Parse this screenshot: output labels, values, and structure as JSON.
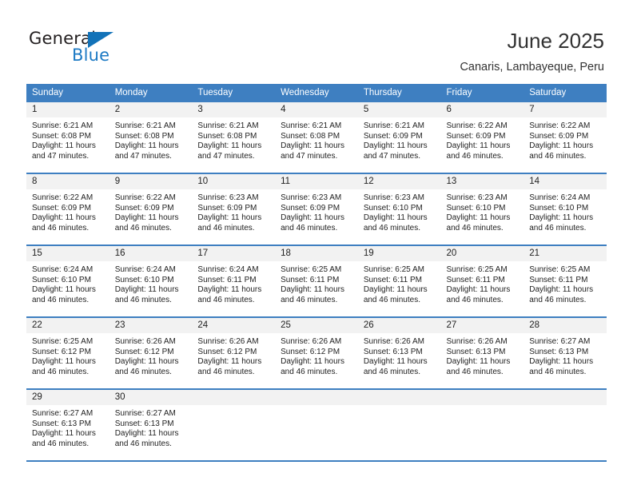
{
  "brand": {
    "name_top": "General",
    "name_bottom": "Blue",
    "accent_color": "#1272b8"
  },
  "header": {
    "title": "June 2025",
    "subtitle": "Canaris, Lambayeque, Peru"
  },
  "calendar": {
    "header_bg": "#3e7fc1",
    "daynum_bg": "#f2f2f2",
    "weekday_headers": [
      "Sunday",
      "Monday",
      "Tuesday",
      "Wednesday",
      "Thursday",
      "Friday",
      "Saturday"
    ],
    "weeks": [
      [
        {
          "day": "1",
          "sunrise": "Sunrise: 6:21 AM",
          "sunset": "Sunset: 6:08 PM",
          "daylight_line1": "Daylight: 11 hours",
          "daylight_line2": "and 47 minutes."
        },
        {
          "day": "2",
          "sunrise": "Sunrise: 6:21 AM",
          "sunset": "Sunset: 6:08 PM",
          "daylight_line1": "Daylight: 11 hours",
          "daylight_line2": "and 47 minutes."
        },
        {
          "day": "3",
          "sunrise": "Sunrise: 6:21 AM",
          "sunset": "Sunset: 6:08 PM",
          "daylight_line1": "Daylight: 11 hours",
          "daylight_line2": "and 47 minutes."
        },
        {
          "day": "4",
          "sunrise": "Sunrise: 6:21 AM",
          "sunset": "Sunset: 6:08 PM",
          "daylight_line1": "Daylight: 11 hours",
          "daylight_line2": "and 47 minutes."
        },
        {
          "day": "5",
          "sunrise": "Sunrise: 6:21 AM",
          "sunset": "Sunset: 6:09 PM",
          "daylight_line1": "Daylight: 11 hours",
          "daylight_line2": "and 47 minutes."
        },
        {
          "day": "6",
          "sunrise": "Sunrise: 6:22 AM",
          "sunset": "Sunset: 6:09 PM",
          "daylight_line1": "Daylight: 11 hours",
          "daylight_line2": "and 46 minutes."
        },
        {
          "day": "7",
          "sunrise": "Sunrise: 6:22 AM",
          "sunset": "Sunset: 6:09 PM",
          "daylight_line1": "Daylight: 11 hours",
          "daylight_line2": "and 46 minutes."
        }
      ],
      [
        {
          "day": "8",
          "sunrise": "Sunrise: 6:22 AM",
          "sunset": "Sunset: 6:09 PM",
          "daylight_line1": "Daylight: 11 hours",
          "daylight_line2": "and 46 minutes."
        },
        {
          "day": "9",
          "sunrise": "Sunrise: 6:22 AM",
          "sunset": "Sunset: 6:09 PM",
          "daylight_line1": "Daylight: 11 hours",
          "daylight_line2": "and 46 minutes."
        },
        {
          "day": "10",
          "sunrise": "Sunrise: 6:23 AM",
          "sunset": "Sunset: 6:09 PM",
          "daylight_line1": "Daylight: 11 hours",
          "daylight_line2": "and 46 minutes."
        },
        {
          "day": "11",
          "sunrise": "Sunrise: 6:23 AM",
          "sunset": "Sunset: 6:09 PM",
          "daylight_line1": "Daylight: 11 hours",
          "daylight_line2": "and 46 minutes."
        },
        {
          "day": "12",
          "sunrise": "Sunrise: 6:23 AM",
          "sunset": "Sunset: 6:10 PM",
          "daylight_line1": "Daylight: 11 hours",
          "daylight_line2": "and 46 minutes."
        },
        {
          "day": "13",
          "sunrise": "Sunrise: 6:23 AM",
          "sunset": "Sunset: 6:10 PM",
          "daylight_line1": "Daylight: 11 hours",
          "daylight_line2": "and 46 minutes."
        },
        {
          "day": "14",
          "sunrise": "Sunrise: 6:24 AM",
          "sunset": "Sunset: 6:10 PM",
          "daylight_line1": "Daylight: 11 hours",
          "daylight_line2": "and 46 minutes."
        }
      ],
      [
        {
          "day": "15",
          "sunrise": "Sunrise: 6:24 AM",
          "sunset": "Sunset: 6:10 PM",
          "daylight_line1": "Daylight: 11 hours",
          "daylight_line2": "and 46 minutes."
        },
        {
          "day": "16",
          "sunrise": "Sunrise: 6:24 AM",
          "sunset": "Sunset: 6:10 PM",
          "daylight_line1": "Daylight: 11 hours",
          "daylight_line2": "and 46 minutes."
        },
        {
          "day": "17",
          "sunrise": "Sunrise: 6:24 AM",
          "sunset": "Sunset: 6:11 PM",
          "daylight_line1": "Daylight: 11 hours",
          "daylight_line2": "and 46 minutes."
        },
        {
          "day": "18",
          "sunrise": "Sunrise: 6:25 AM",
          "sunset": "Sunset: 6:11 PM",
          "daylight_line1": "Daylight: 11 hours",
          "daylight_line2": "and 46 minutes."
        },
        {
          "day": "19",
          "sunrise": "Sunrise: 6:25 AM",
          "sunset": "Sunset: 6:11 PM",
          "daylight_line1": "Daylight: 11 hours",
          "daylight_line2": "and 46 minutes."
        },
        {
          "day": "20",
          "sunrise": "Sunrise: 6:25 AM",
          "sunset": "Sunset: 6:11 PM",
          "daylight_line1": "Daylight: 11 hours",
          "daylight_line2": "and 46 minutes."
        },
        {
          "day": "21",
          "sunrise": "Sunrise: 6:25 AM",
          "sunset": "Sunset: 6:11 PM",
          "daylight_line1": "Daylight: 11 hours",
          "daylight_line2": "and 46 minutes."
        }
      ],
      [
        {
          "day": "22",
          "sunrise": "Sunrise: 6:25 AM",
          "sunset": "Sunset: 6:12 PM",
          "daylight_line1": "Daylight: 11 hours",
          "daylight_line2": "and 46 minutes."
        },
        {
          "day": "23",
          "sunrise": "Sunrise: 6:26 AM",
          "sunset": "Sunset: 6:12 PM",
          "daylight_line1": "Daylight: 11 hours",
          "daylight_line2": "and 46 minutes."
        },
        {
          "day": "24",
          "sunrise": "Sunrise: 6:26 AM",
          "sunset": "Sunset: 6:12 PM",
          "daylight_line1": "Daylight: 11 hours",
          "daylight_line2": "and 46 minutes."
        },
        {
          "day": "25",
          "sunrise": "Sunrise: 6:26 AM",
          "sunset": "Sunset: 6:12 PM",
          "daylight_line1": "Daylight: 11 hours",
          "daylight_line2": "and 46 minutes."
        },
        {
          "day": "26",
          "sunrise": "Sunrise: 6:26 AM",
          "sunset": "Sunset: 6:13 PM",
          "daylight_line1": "Daylight: 11 hours",
          "daylight_line2": "and 46 minutes."
        },
        {
          "day": "27",
          "sunrise": "Sunrise: 6:26 AM",
          "sunset": "Sunset: 6:13 PM",
          "daylight_line1": "Daylight: 11 hours",
          "daylight_line2": "and 46 minutes."
        },
        {
          "day": "28",
          "sunrise": "Sunrise: 6:27 AM",
          "sunset": "Sunset: 6:13 PM",
          "daylight_line1": "Daylight: 11 hours",
          "daylight_line2": "and 46 minutes."
        }
      ],
      [
        {
          "day": "29",
          "sunrise": "Sunrise: 6:27 AM",
          "sunset": "Sunset: 6:13 PM",
          "daylight_line1": "Daylight: 11 hours",
          "daylight_line2": "and 46 minutes."
        },
        {
          "day": "30",
          "sunrise": "Sunrise: 6:27 AM",
          "sunset": "Sunset: 6:13 PM",
          "daylight_line1": "Daylight: 11 hours",
          "daylight_line2": "and 46 minutes."
        },
        {
          "day": "",
          "sunrise": "",
          "sunset": "",
          "daylight_line1": "",
          "daylight_line2": ""
        },
        {
          "day": "",
          "sunrise": "",
          "sunset": "",
          "daylight_line1": "",
          "daylight_line2": ""
        },
        {
          "day": "",
          "sunrise": "",
          "sunset": "",
          "daylight_line1": "",
          "daylight_line2": ""
        },
        {
          "day": "",
          "sunrise": "",
          "sunset": "",
          "daylight_line1": "",
          "daylight_line2": ""
        },
        {
          "day": "",
          "sunrise": "",
          "sunset": "",
          "daylight_line1": "",
          "daylight_line2": ""
        }
      ]
    ]
  }
}
